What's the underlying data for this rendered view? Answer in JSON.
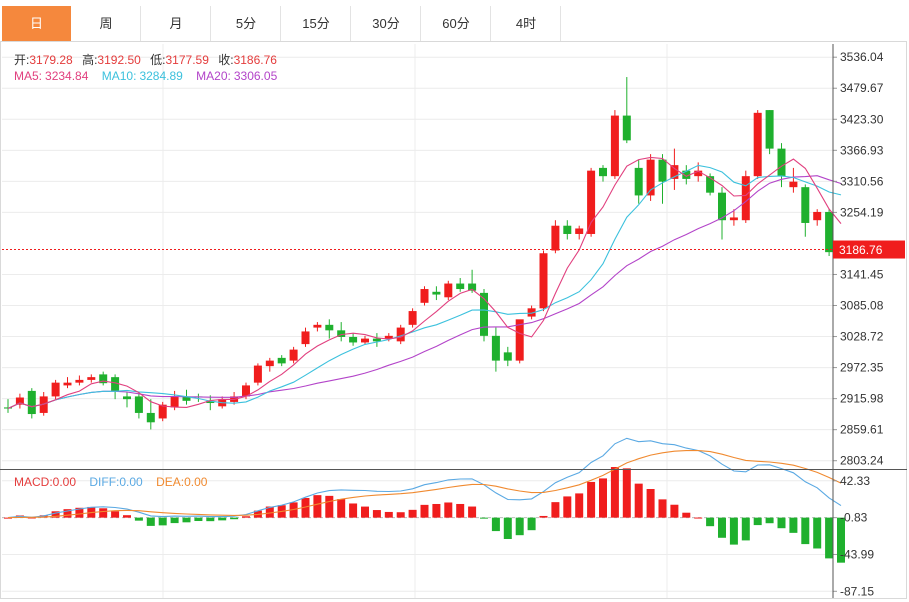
{
  "tabs": [
    {
      "label": "日",
      "active": true
    },
    {
      "label": "周",
      "active": false
    },
    {
      "label": "月",
      "active": false
    },
    {
      "label": "5分",
      "active": false
    },
    {
      "label": "15分",
      "active": false
    },
    {
      "label": "30分",
      "active": false
    },
    {
      "label": "60分",
      "active": false
    },
    {
      "label": "4时",
      "active": false
    }
  ],
  "ohlc_info": {
    "open_label": "开:",
    "open": "3179.28",
    "high_label": "高:",
    "high": "3192.50",
    "low_label": "低:",
    "low": "3177.59",
    "close_label": "收:",
    "close": "3186.76"
  },
  "ma_info": {
    "ma5_label": "MA5:",
    "ma5": "3234.84",
    "ma10_label": "MA10:",
    "ma10": "3284.89",
    "ma20_label": "MA20:",
    "ma20": "3306.05"
  },
  "macd_info": {
    "macd_label": "MACD:",
    "macd": "0.00",
    "diff_label": "DIFF:",
    "diff": "0.00",
    "dea_label": "DEA:",
    "dea": "0.00"
  },
  "current_price": "3186.76",
  "colors": {
    "up": "#f01d1d",
    "down": "#1fb02e",
    "accent": "#f5883d",
    "ma5": "#e1407f",
    "ma10": "#3cc1dd",
    "ma20": "#b344c9",
    "diff": "#5aa9e3",
    "dea": "#f08a30"
  },
  "chart_data": [
    {
      "type": "candlestick",
      "ylim": [
        2790,
        3560
      ],
      "y_ticks": [
        "3536.04",
        "3479.67",
        "3423.30",
        "3366.93",
        "3310.56",
        "3254.19",
        "3141.45",
        "3085.08",
        "3028.72",
        "2972.35",
        "2915.98",
        "2859.61",
        "2803.24"
      ],
      "candles": [
        [
          2900,
          2915,
          2890,
          2898
        ],
        [
          2905,
          2925,
          2898,
          2918
        ],
        [
          2930,
          2935,
          2880,
          2888
        ],
        [
          2890,
          2928,
          2885,
          2920
        ],
        [
          2920,
          2950,
          2915,
          2945
        ],
        [
          2940,
          2955,
          2935,
          2945
        ],
        [
          2945,
          2958,
          2940,
          2950
        ],
        [
          2950,
          2960,
          2945,
          2955
        ],
        [
          2960,
          2965,
          2940,
          2944
        ],
        [
          2955,
          2960,
          2915,
          2930
        ],
        [
          2920,
          2928,
          2900,
          2915
        ],
        [
          2920,
          2928,
          2880,
          2890
        ],
        [
          2890,
          2915,
          2860,
          2873
        ],
        [
          2880,
          2910,
          2875,
          2905
        ],
        [
          2900,
          2930,
          2895,
          2920
        ],
        [
          2920,
          2932,
          2905,
          2912
        ],
        [
          2920,
          2925,
          2910,
          2918
        ],
        [
          2912,
          2922,
          2895,
          2908
        ],
        [
          2902,
          2920,
          2898,
          2915
        ],
        [
          2910,
          2928,
          2905,
          2920
        ],
        [
          2920,
          2945,
          2915,
          2940
        ],
        [
          2945,
          2980,
          2940,
          2976
        ],
        [
          2975,
          2990,
          2965,
          2985
        ],
        [
          2990,
          2995,
          2975,
          2980
        ],
        [
          2985,
          3010,
          2980,
          3005
        ],
        [
          3015,
          3045,
          3010,
          3038
        ],
        [
          3045,
          3055,
          3038,
          3050
        ],
        [
          3050,
          3060,
          3025,
          3040
        ],
        [
          3040,
          3055,
          3020,
          3028
        ],
        [
          3028,
          3035,
          3012,
          3018
        ],
        [
          3018,
          3030,
          3015,
          3025
        ],
        [
          3025,
          3035,
          3010,
          3020
        ],
        [
          3025,
          3035,
          3020,
          3030
        ],
        [
          3020,
          3050,
          3015,
          3045
        ],
        [
          3050,
          3080,
          3045,
          3075
        ],
        [
          3090,
          3120,
          3085,
          3115
        ],
        [
          3110,
          3120,
          3095,
          3105
        ],
        [
          3100,
          3130,
          3095,
          3125
        ],
        [
          3125,
          3135,
          3110,
          3115
        ],
        [
          3125,
          3150,
          3108,
          3112
        ],
        [
          3108,
          3115,
          3020,
          3030
        ],
        [
          3030,
          3045,
          2965,
          2985
        ],
        [
          3000,
          3010,
          2975,
          2985
        ],
        [
          2985,
          3055,
          2980,
          3060
        ],
        [
          3065,
          3085,
          3060,
          3080
        ],
        [
          3080,
          3185,
          3075,
          3180
        ],
        [
          3185,
          3240,
          3180,
          3230
        ],
        [
          3230,
          3240,
          3205,
          3215
        ],
        [
          3215,
          3230,
          3205,
          3225
        ],
        [
          3215,
          3335,
          3210,
          3330
        ],
        [
          3335,
          3340,
          3310,
          3320
        ],
        [
          3320,
          3440,
          3315,
          3430
        ],
        [
          3430,
          3500,
          3380,
          3385
        ],
        [
          3335,
          3350,
          3270,
          3285
        ],
        [
          3285,
          3360,
          3275,
          3350
        ],
        [
          3350,
          3360,
          3270,
          3310
        ],
        [
          3315,
          3370,
          3295,
          3340
        ],
        [
          3330,
          3340,
          3305,
          3315
        ],
        [
          3320,
          3345,
          3310,
          3330
        ],
        [
          3320,
          3325,
          3285,
          3290
        ],
        [
          3290,
          3300,
          3205,
          3240
        ],
        [
          3240,
          3260,
          3230,
          3245
        ],
        [
          3240,
          3330,
          3235,
          3320
        ],
        [
          3320,
          3440,
          3315,
          3435
        ],
        [
          3440,
          3440,
          3360,
          3370
        ],
        [
          3370,
          3380,
          3300,
          3320
        ],
        [
          3300,
          3335,
          3290,
          3310
        ],
        [
          3300,
          3305,
          3210,
          3235
        ],
        [
          3240,
          3260,
          3230,
          3255
        ],
        [
          3255,
          3260,
          3175,
          3182
        ],
        [
          3179.28,
          3192.5,
          3177.59,
          3186.76
        ]
      ]
    },
    {
      "type": "macd",
      "ylim": [
        -95,
        55
      ],
      "y_ticks": [
        "42.33",
        "-0.83",
        "-43.99",
        "-87.15"
      ]
    }
  ]
}
